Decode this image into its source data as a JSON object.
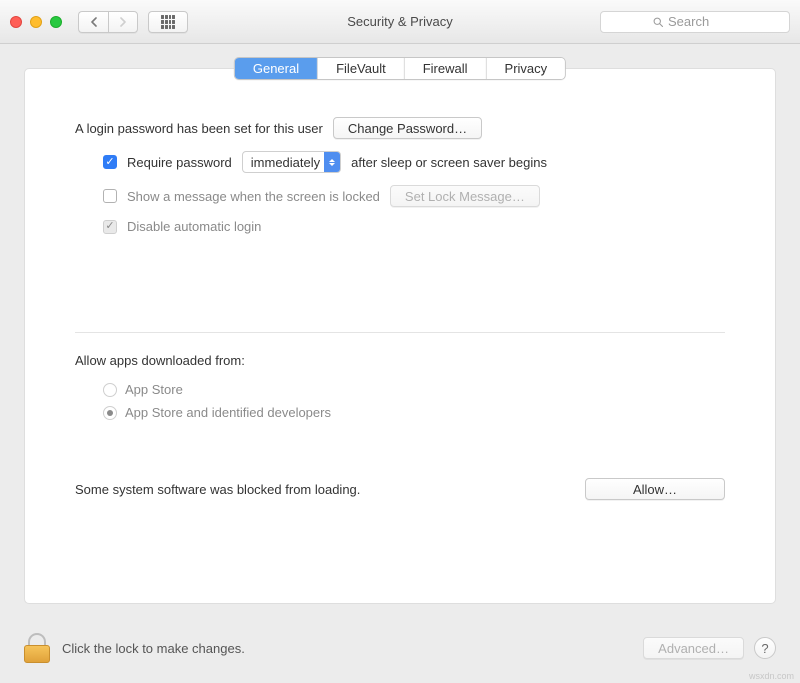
{
  "window": {
    "title": "Security & Privacy"
  },
  "search": {
    "placeholder": "Search"
  },
  "tabs": [
    {
      "label": "General",
      "active": true
    },
    {
      "label": "FileVault",
      "active": false
    },
    {
      "label": "Firewall",
      "active": false
    },
    {
      "label": "Privacy",
      "active": false
    }
  ],
  "general": {
    "login_password_set_text": "A login password has been set for this user",
    "change_password_label": "Change Password…",
    "require_password_checked": true,
    "require_password_prefix": "Require password",
    "require_password_delay": "immediately",
    "require_password_suffix": "after sleep or screen saver begins",
    "show_message_checked": false,
    "show_message_label": "Show a message when the screen is locked",
    "set_lock_message_label": "Set Lock Message…",
    "disable_auto_login_checked": true,
    "disable_auto_login_label": "Disable automatic login"
  },
  "gatekeeper": {
    "title": "Allow apps downloaded from:",
    "options": [
      {
        "label": "App Store",
        "selected": false
      },
      {
        "label": "App Store and identified developers",
        "selected": true
      }
    ],
    "blocked_text": "Some system software was blocked from loading.",
    "allow_label": "Allow…"
  },
  "footer": {
    "lock_text": "Click the lock to make changes.",
    "advanced_label": "Advanced…"
  },
  "watermark": "wsxdn.com"
}
